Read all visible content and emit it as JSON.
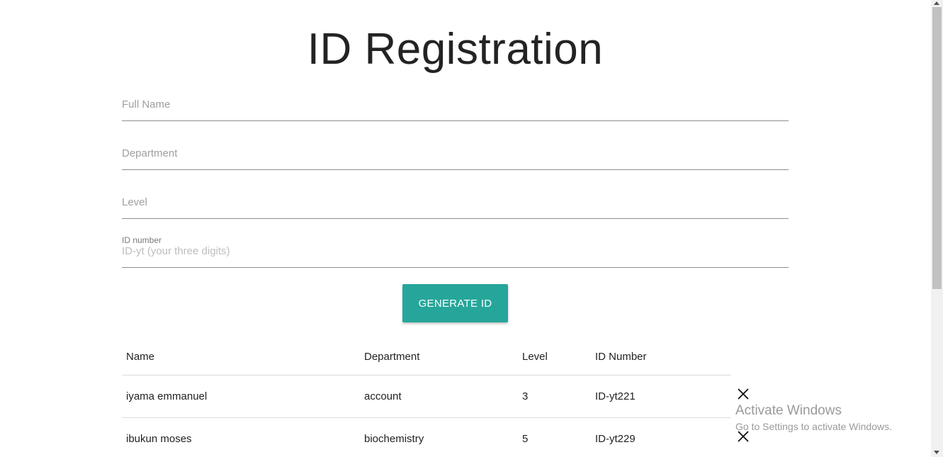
{
  "page": {
    "title": "ID Registration"
  },
  "form": {
    "full_name": {
      "placeholder": "Full Name",
      "value": ""
    },
    "department": {
      "placeholder": "Department",
      "value": ""
    },
    "level": {
      "placeholder": "Level",
      "value": ""
    },
    "id_number": {
      "label": "ID number",
      "placeholder": "ID-yt (your three digits)",
      "value": ""
    },
    "generate_label": "GENERATE ID"
  },
  "table": {
    "headers": {
      "name": "Name",
      "department": "Department",
      "level": "Level",
      "id_number": "ID Number"
    },
    "rows": [
      {
        "name": "iyama emmanuel",
        "department": "account",
        "level": "3",
        "id_number": "ID-yt221",
        "delete_icon": "close-icon"
      },
      {
        "name": "ibukun moses",
        "department": "biochemistry",
        "level": "5",
        "id_number": "ID-yt229",
        "delete_icon": "close-icon"
      }
    ]
  },
  "watermark": {
    "title": "Activate Windows",
    "subtitle": "Go to Settings to activate Windows."
  },
  "colors": {
    "accent": "#26a69a",
    "text": "#222222",
    "underline": "#8d8d8d"
  }
}
